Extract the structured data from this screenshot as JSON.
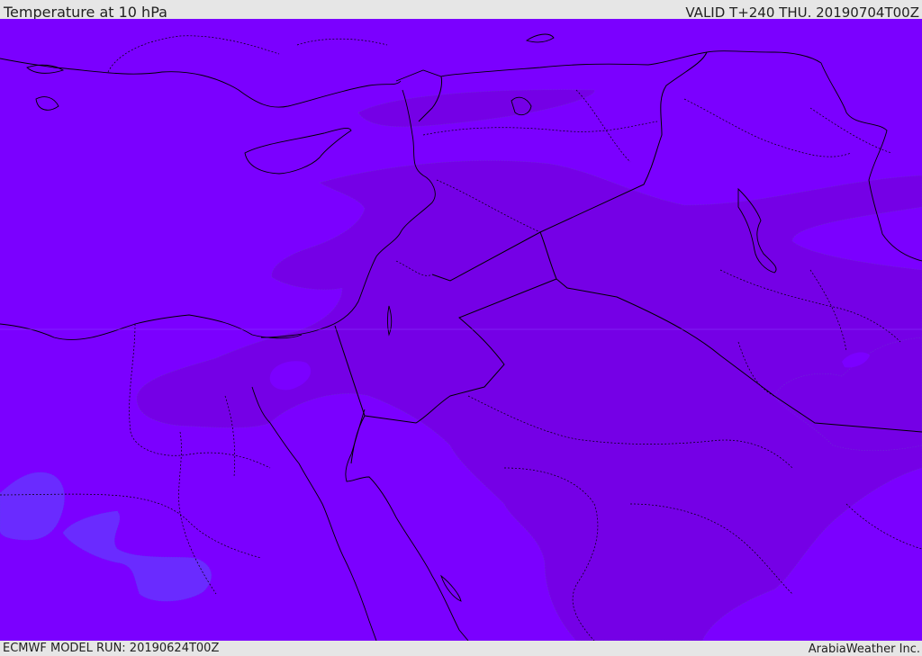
{
  "header": {
    "title": "Temperature at 10 hPa",
    "valid": "VALID T+240 THU. 20190704T00Z"
  },
  "footer": {
    "model_run": "ECMWF MODEL RUN: 20190624T00Z",
    "credit": "ArabiaWeather Inc."
  },
  "map": {
    "colors": {
      "base_field": "#7b00ff",
      "warm_band": "#7500e6",
      "cool_pocket": "#6a2bff",
      "coastline": "#000000",
      "border": "#000000"
    }
  }
}
